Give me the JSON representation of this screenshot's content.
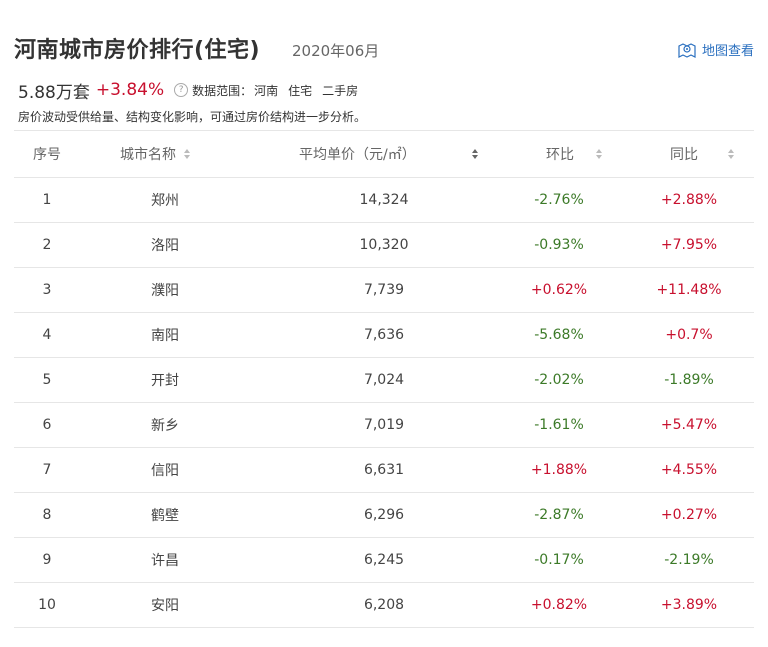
{
  "header": {
    "title": "河南城市房价排行(住宅)",
    "date": "2020年06月",
    "map_link": "地图查看"
  },
  "summary": {
    "avg_price": "5.88万套",
    "change": "+3.84%",
    "scope_label": "数据范围：",
    "scope": [
      "河南",
      "住宅",
      "二手房"
    ],
    "note": "房价波动受供给量、结构变化影响，可通过房价结构进一步分析。"
  },
  "table": {
    "headers": {
      "rank": "序号",
      "city": "城市名称",
      "price": "平均单价（元/㎡）",
      "mom": "环比",
      "yoy": "同比"
    },
    "rows": [
      {
        "rank": "1",
        "city": "郑州",
        "price": "14,324",
        "mom": "-2.76%",
        "yoy": "+2.88%"
      },
      {
        "rank": "2",
        "city": "洛阳",
        "price": "10,320",
        "mom": "-0.93%",
        "yoy": "+7.95%"
      },
      {
        "rank": "3",
        "city": "濮阳",
        "price": "7,739",
        "mom": "+0.62%",
        "yoy": "+11.48%"
      },
      {
        "rank": "4",
        "city": "南阳",
        "price": "7,636",
        "mom": "-5.68%",
        "yoy": "+0.7%"
      },
      {
        "rank": "5",
        "city": "开封",
        "price": "7,024",
        "mom": "-2.02%",
        "yoy": "-1.89%"
      },
      {
        "rank": "6",
        "city": "新乡",
        "price": "7,019",
        "mom": "-1.61%",
        "yoy": "+5.47%"
      },
      {
        "rank": "7",
        "city": "信阳",
        "price": "6,631",
        "mom": "+1.88%",
        "yoy": "+4.55%"
      },
      {
        "rank": "8",
        "city": "鹤壁",
        "price": "6,296",
        "mom": "-2.87%",
        "yoy": "+0.27%"
      },
      {
        "rank": "9",
        "city": "许昌",
        "price": "6,245",
        "mom": "-0.17%",
        "yoy": "-2.19%"
      },
      {
        "rank": "10",
        "city": "安阳",
        "price": "6,208",
        "mom": "+0.82%",
        "yoy": "+3.89%"
      }
    ]
  },
  "colors": {
    "positive": "#c8102e",
    "negative": "#3c7a28",
    "link": "#2a6fbf"
  }
}
